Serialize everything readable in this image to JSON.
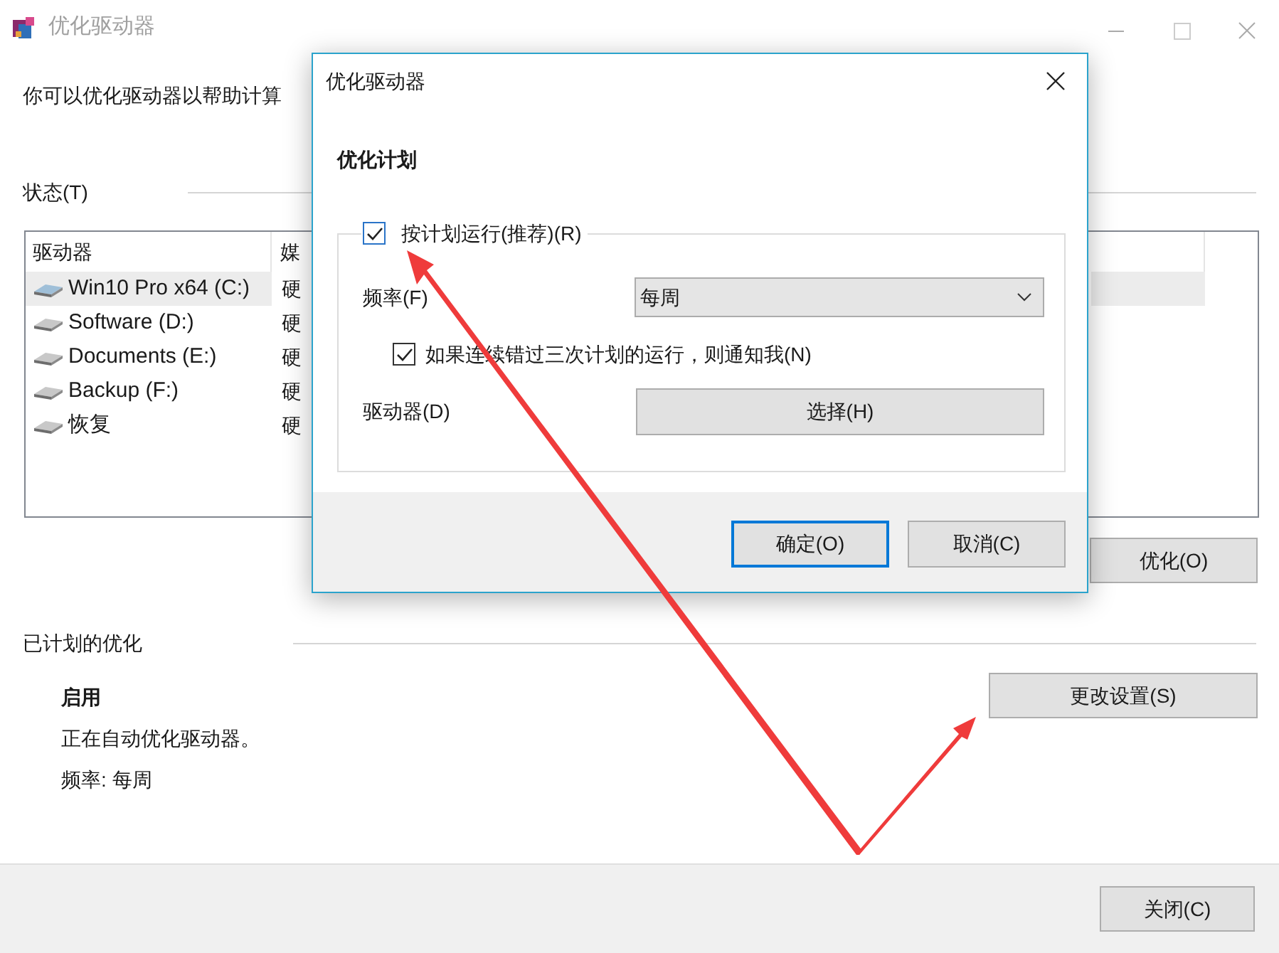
{
  "window": {
    "title": "优化驱动器",
    "description": "你可以优化驱动器以帮助计算"
  },
  "status": {
    "label": "状态(T)",
    "columns": [
      "驱动器",
      "媒"
    ],
    "rows": [
      {
        "name": "Win10 Pro x64 (C:)",
        "media": "硬",
        "selected": true
      },
      {
        "name": "Software (D:)",
        "media": "硬",
        "selected": false
      },
      {
        "name": "Documents (E:)",
        "media": "硬",
        "selected": false
      },
      {
        "name": "Backup (F:)",
        "media": "硬",
        "selected": false
      },
      {
        "name": "恢复",
        "media": "硬",
        "selected": false
      }
    ]
  },
  "optimize_button": "优化(O)",
  "scheduled": {
    "label": "已计划的优化",
    "state": "启用",
    "description": "正在自动优化驱动器。",
    "frequency": "频率: 每周",
    "button": "更改设置(S)"
  },
  "close_button": "关闭(C)",
  "dialog": {
    "title": "优化驱动器",
    "heading": "优化计划",
    "run_on_schedule": {
      "label": "按计划运行(推荐)(R)",
      "checked": true
    },
    "frequency": {
      "label": "频率(F)",
      "value": "每周"
    },
    "notify": {
      "label": "如果连续错过三次计划的运行，则通知我(N)",
      "checked": true
    },
    "drives": {
      "label": "驱动器(D)",
      "button": "选择(H)"
    },
    "buttons": [
      {
        "label": "确定(O)",
        "default": true
      },
      {
        "label": "取消(C)",
        "default": false
      }
    ]
  }
}
